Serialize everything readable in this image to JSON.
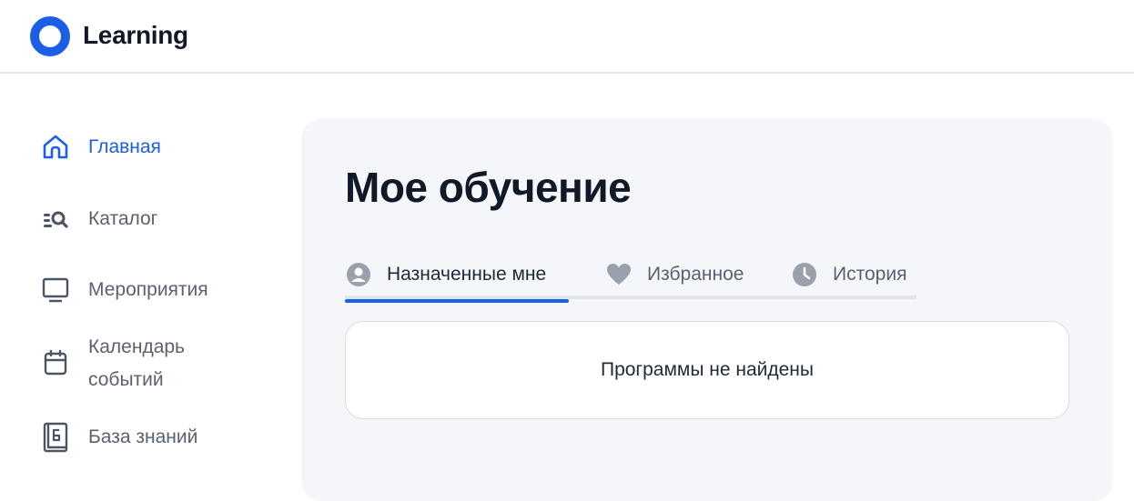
{
  "header": {
    "brand": "Learning",
    "logo_icon": "circle-logo-icon",
    "brand_color": "#1a5fe5"
  },
  "sidebar": {
    "items": [
      {
        "label": "Главная",
        "icon": "home-icon",
        "active": true
      },
      {
        "label": "Каталог",
        "icon": "catalog-search-icon",
        "active": false
      },
      {
        "label": "Мероприятия",
        "icon": "monitor-icon",
        "active": false
      },
      {
        "label_line1": "Календарь",
        "label_line2": "событий",
        "icon": "calendar-icon",
        "active": false
      },
      {
        "label": "База знаний",
        "icon": "knowledge-book-icon",
        "active": false
      }
    ]
  },
  "main": {
    "title": "Мое обучение",
    "tabs": [
      {
        "label": "Назначенные мне",
        "icon": "user-circle-icon",
        "active": true
      },
      {
        "label": "Избранное",
        "icon": "heart-icon",
        "active": false
      },
      {
        "label": "История",
        "icon": "clock-icon",
        "active": false
      }
    ],
    "empty_message": "Программы не найдены"
  },
  "colors": {
    "accent": "#1a5fe5",
    "text_muted": "#5a6170",
    "panel_bg": "#f4f6f9"
  }
}
